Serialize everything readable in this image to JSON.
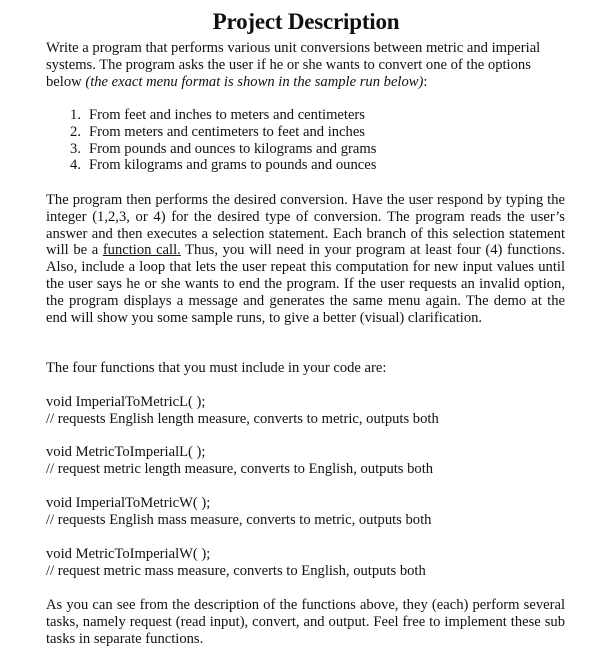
{
  "title": "Project Description",
  "intro": {
    "text_before": "Write a program that performs various unit conversions between metric and imperial systems. The program asks the user if he or she wants to convert one of the options below ",
    "italic": "(the exact menu format is shown in the sample run below)",
    "text_after": ":"
  },
  "options": [
    {
      "num": "1.",
      "text": "From feet and inches to meters and centimeters"
    },
    {
      "num": "2.",
      "text": "From meters and centimeters to feet and inches"
    },
    {
      "num": "3.",
      "text": "From pounds and ounces to kilograms and grams"
    },
    {
      "num": "4.",
      "text": "From kilograms and grams to pounds and ounces"
    }
  ],
  "details": {
    "text_before": "The program then performs the desired conversion. Have the user respond by typing the integer (1,2,3, or 4) for the desired type of conversion. The program reads the user’s answer and then executes a selection statement. Each branch of this selection statement will be a ",
    "underlined": "function call.",
    "text_after": " Thus, you will need in your program at least four (4) functions. Also, include a loop that lets the user repeat this computation for new input values until the user says he or she wants to end the program. If the user requests an invalid option, the program displays a message and generates the same menu again. The demo at the end will show you some sample runs, to give a better (visual) clarification."
  },
  "functions_intro": "The four functions that you must include in your code are:",
  "functions": [
    {
      "signature": "void ImperialToMetricL( );",
      "comment": "// requests English length measure, converts to metric, outputs both"
    },
    {
      "signature": "void MetricToImperialL( );",
      "comment": "// request metric length measure, converts to English, outputs both"
    },
    {
      "signature": "void ImperialToMetricW( );",
      "comment": "// requests English mass measure, converts to metric, outputs both"
    },
    {
      "signature": "void MetricToImperialW( );",
      "comment": "// request metric mass measure, converts to English, outputs both"
    }
  ],
  "closing": "As you can see from the description of the functions above, they (each) perform several tasks, namely request (read input), convert, and output. Feel free to implement these sub tasks in separate functions."
}
